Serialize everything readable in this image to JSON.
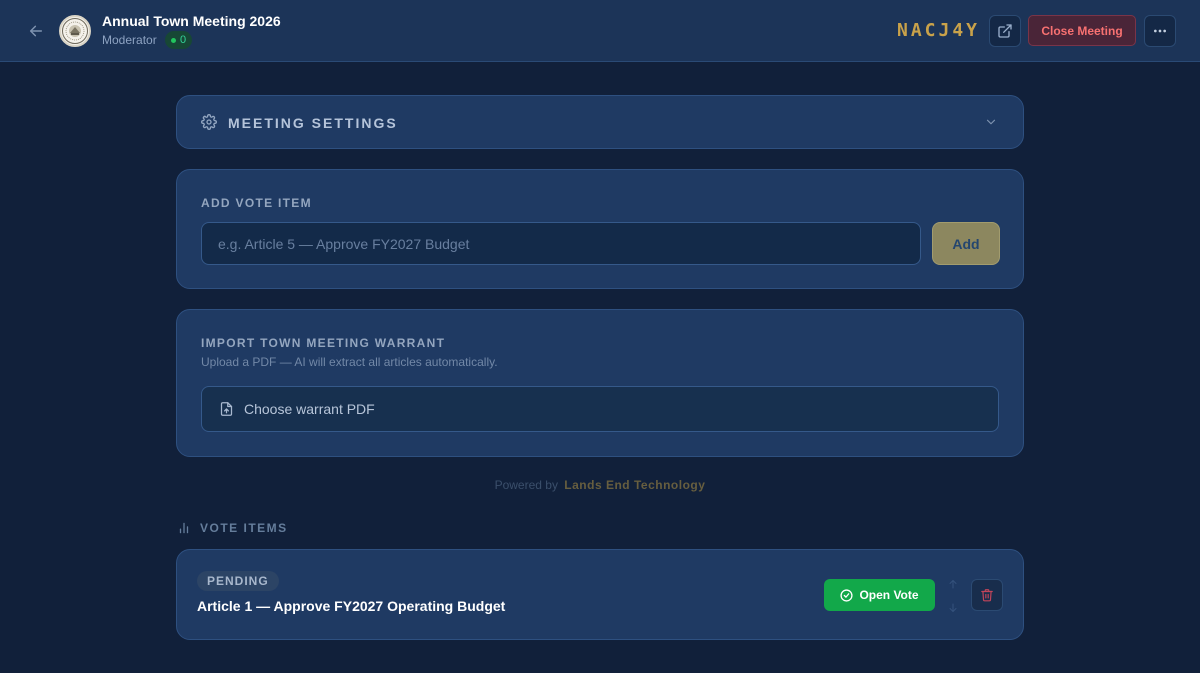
{
  "header": {
    "title": "Annual Town Meeting 2026",
    "role": "Moderator",
    "participant_count": "0",
    "room_code": "NACJ4Y",
    "close_label": "Close Meeting"
  },
  "settings": {
    "label": "MEETING SETTINGS"
  },
  "add_vote": {
    "label": "ADD VOTE ITEM",
    "placeholder": "e.g. Article 5 — Approve FY2027 Budget",
    "value": "",
    "button_label": "Add"
  },
  "import_warrant": {
    "label": "IMPORT TOWN MEETING WARRANT",
    "subtitle": "Upload a PDF — AI will extract all articles automatically.",
    "button_label": "Choose warrant PDF"
  },
  "footer": {
    "powered_by": "Powered by",
    "brand": "Lands End Technology"
  },
  "vote_items": {
    "label": "VOTE ITEMS",
    "items": [
      {
        "status": "PENDING",
        "title": "Article 1 — Approve FY2027 Operating Budget",
        "action_label": "Open Vote"
      }
    ]
  },
  "colors": {
    "background": "#11203a",
    "card": "#1f3a63",
    "accent_gold": "#c9a24a",
    "danger": "#f87171",
    "success": "#12a84a"
  },
  "icons": {
    "back": "arrow-left-icon",
    "external": "external-link-icon",
    "more": "more-horizontal-icon",
    "settings": "gear-icon",
    "expand": "chevron-down-icon",
    "upload": "file-upload-icon",
    "vote_items": "bar-chart-icon",
    "open_vote": "check-circle-icon",
    "delete": "trash-icon"
  }
}
